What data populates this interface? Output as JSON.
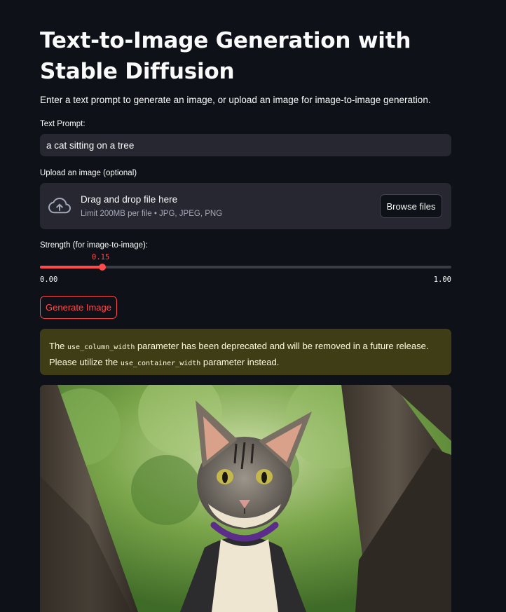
{
  "page": {
    "title_line1": "Text-to-Image Generation with",
    "title_line2": "Stable Diffusion",
    "intro": "Enter a text prompt to generate an image, or upload an image for image-to-image generation."
  },
  "prompt": {
    "label": "Text Prompt:",
    "value": "a cat sitting on a tree"
  },
  "upload": {
    "label": "Upload an image (optional)",
    "drop_title": "Drag and drop file here",
    "drop_limit": "Limit 200MB per file • JPG, JPEG, PNG",
    "browse_label": "Browse files",
    "icon": "cloud-upload-icon"
  },
  "strength": {
    "label": "Strength (for image-to-image):",
    "value": "0.15",
    "min": "0.00",
    "max": "1.00"
  },
  "generate": {
    "label": "Generate Image"
  },
  "warning": {
    "text_1": "The ",
    "code_1": "use_column_width",
    "text_2": " parameter has been deprecated and will be removed in a future release. Please utilize the ",
    "code_2": "use_container_width",
    "text_3": " parameter instead."
  },
  "colors": {
    "background": "#0e1117",
    "accent": "#ff4b4b",
    "input_bg": "#262730",
    "warning_bg": "#3e3d16"
  }
}
